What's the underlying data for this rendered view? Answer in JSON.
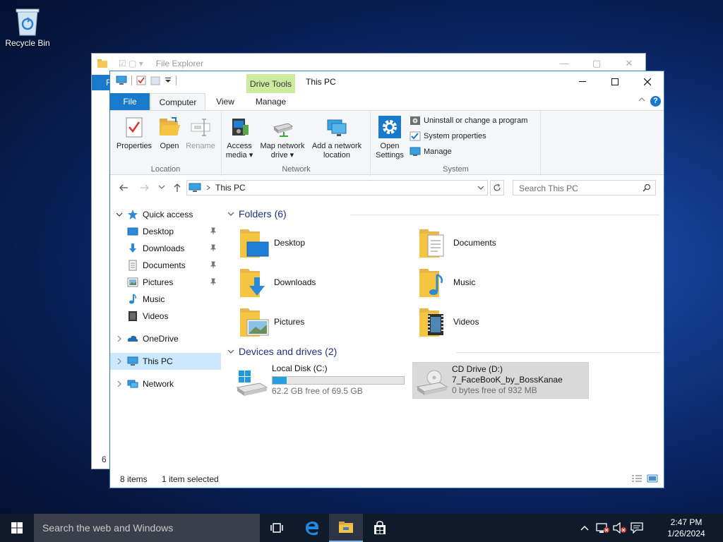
{
  "desktop": {
    "recycle_bin": "Recycle Bin"
  },
  "bg_window": {
    "title": "File Explorer",
    "file_tab": "F",
    "status_fragment": "6"
  },
  "window": {
    "title": "This PC",
    "context_tab": "Drive Tools",
    "tabs": {
      "file": "File",
      "computer": "Computer",
      "view": "View",
      "manage": "Manage"
    },
    "ribbon": {
      "location": {
        "label": "Location",
        "properties": "Properties",
        "open": "Open",
        "rename": "Rename"
      },
      "network": {
        "label": "Network",
        "access_media_1": "Access",
        "access_media_2": "media",
        "map_drive_1": "Map network",
        "map_drive_2": "drive",
        "add_location_1": "Add a network",
        "add_location_2": "location"
      },
      "system": {
        "label": "System",
        "open_settings_1": "Open",
        "open_settings_2": "Settings",
        "uninstall": "Uninstall or change a program",
        "properties": "System properties",
        "manage": "Manage"
      }
    },
    "address": {
      "path": "This PC",
      "search_placeholder": "Search This PC"
    },
    "nav": {
      "quick_access": "Quick access",
      "items": [
        "Desktop",
        "Downloads",
        "Documents",
        "Pictures",
        "Music",
        "Videos"
      ],
      "onedrive": "OneDrive",
      "this_pc": "This PC",
      "network": "Network"
    },
    "folders": {
      "heading": "Folders (6)",
      "items": [
        "Desktop",
        "Documents",
        "Downloads",
        "Music",
        "Pictures",
        "Videos"
      ]
    },
    "drives": {
      "heading": "Devices and drives (2)",
      "local": {
        "name": "Local Disk (C:)",
        "free": "62.2 GB free of 69.5 GB",
        "used_fraction": 0.105
      },
      "cd": {
        "name": "CD Drive (D:)",
        "label": "7_FaceBooK_by_BossKanae",
        "free": "0 bytes free of 932 MB"
      }
    },
    "status": {
      "count": "8 items",
      "selected": "1 item selected"
    }
  },
  "taskbar": {
    "search_placeholder": "Search the web and Windows",
    "time": "2:47 PM",
    "date": "1/26/2024"
  },
  "colors": {
    "accent": "#1979ca",
    "selection": "#cce8ff",
    "drive_tools": "#cdeb9e",
    "folder": "#f5c542"
  }
}
